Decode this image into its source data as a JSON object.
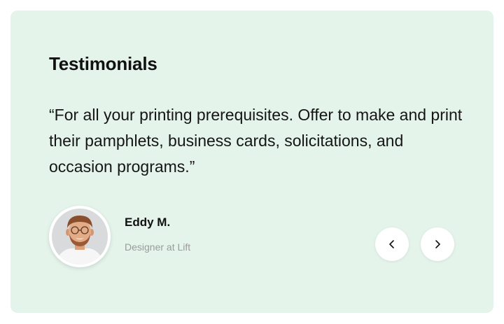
{
  "testimonials": {
    "title": "Testimonials",
    "quote": "“For all your printing prerequisites. Offer to make and print their pamphlets, business cards, solicitations, and occasion programs.”",
    "author": {
      "name": "Eddy M.",
      "role": "Designer at Lift",
      "avatar": "person-photo"
    },
    "controls": {
      "prev_icon": "chevron-left-icon",
      "next_icon": "chevron-right-icon"
    }
  },
  "colors": {
    "card_background": "#e4f4eb",
    "text": "#111111",
    "muted": "#9a9a9a",
    "button_background": "#ffffff"
  }
}
